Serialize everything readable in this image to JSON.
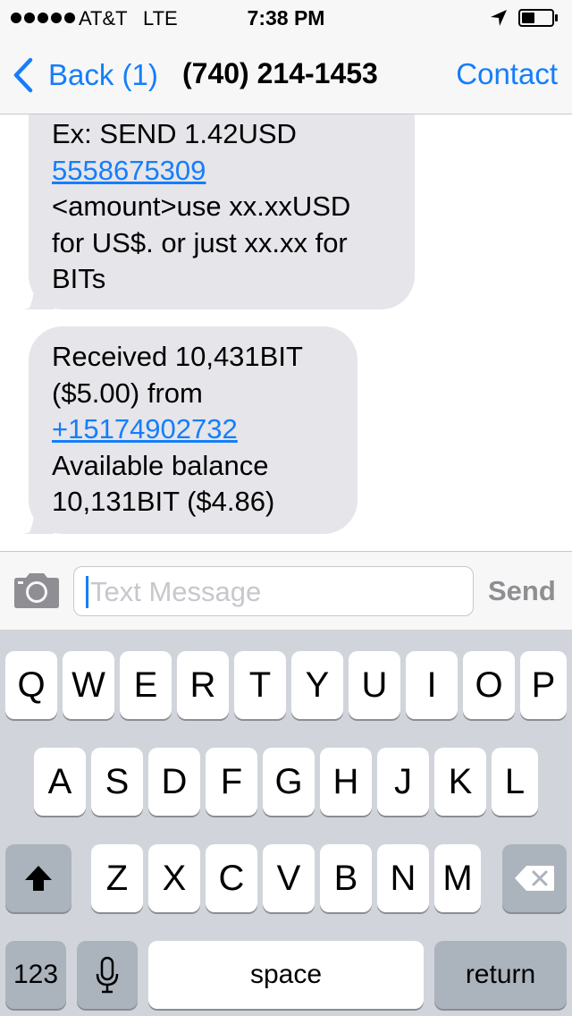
{
  "status_bar": {
    "carrier": "AT&T",
    "network": "LTE",
    "time": "7:38 PM",
    "signal_bars": 5
  },
  "nav": {
    "back_label": "Back (1)",
    "title": "(740) 214-1453",
    "contact_label": "Contact"
  },
  "messages": [
    {
      "lines": [
        {
          "text": "Ex: SEND 1.42USD",
          "link": false
        },
        {
          "text": "5558675309",
          "link": true
        },
        {
          "text": "<amount>use xx.xxUSD",
          "link": false
        },
        {
          "text": "for US$. or just xx.xx for",
          "link": false
        },
        {
          "text": "BITs",
          "link": false
        }
      ]
    },
    {
      "lines": [
        {
          "text": "Received 10,431BIT",
          "link": false
        },
        {
          "text": "($5.00) from",
          "link": false
        },
        {
          "text": "+15174902732",
          "link": true
        },
        {
          "text": "Available balance",
          "link": false
        },
        {
          "text": "10,131BIT ($4.86)",
          "link": false
        }
      ]
    }
  ],
  "composer": {
    "placeholder": "Text Message",
    "send_label": "Send"
  },
  "keyboard": {
    "row1": [
      "Q",
      "W",
      "E",
      "R",
      "T",
      "Y",
      "U",
      "I",
      "O",
      "P"
    ],
    "row2": [
      "A",
      "S",
      "D",
      "F",
      "G",
      "H",
      "J",
      "K",
      "L"
    ],
    "row3": [
      "Z",
      "X",
      "C",
      "V",
      "B",
      "N",
      "M"
    ],
    "numbers_label": "123",
    "space_label": "space",
    "return_label": "return"
  },
  "colors": {
    "accent": "#157efb",
    "bubble_received": "#e5e5ea",
    "keyboard_bg": "#d1d5db"
  }
}
